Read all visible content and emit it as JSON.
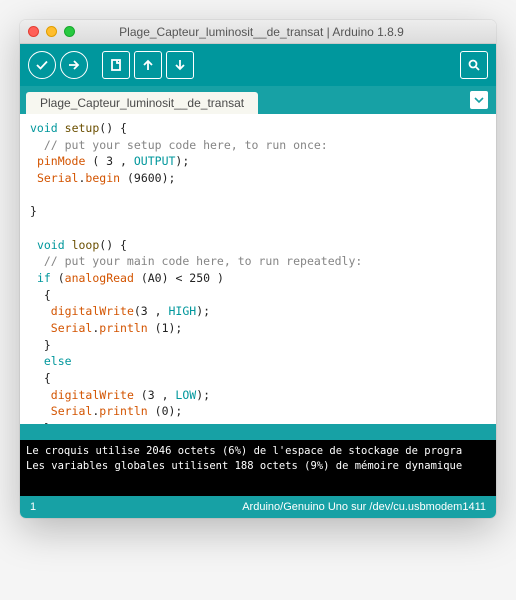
{
  "window": {
    "title": "Plage_Capteur_luminosit__de_transat | Arduino 1.8.9"
  },
  "tabs": {
    "active": "Plage_Capteur_luminosit__de_transat"
  },
  "code": {
    "l1a": "void",
    "l1b": " ",
    "l1c": "setup",
    "l1d": "() {",
    "l2": "  // put your setup code here, to run once:",
    "l3a": " ",
    "l3b": "pinMode",
    "l3c": " ( 3 , ",
    "l3d": "OUTPUT",
    "l3e": ");",
    "l4a": " ",
    "l4b": "Serial",
    "l4c": ".",
    "l4d": "begin",
    "l4e": " (9600);",
    "l5": "",
    "l6": "}",
    "l7": "",
    "l8a": " ",
    "l8b": "void",
    "l8c": " ",
    "l8d": "loop",
    "l8e": "() {",
    "l9": "  // put your main code here, to run repeatedly:",
    "l10a": " ",
    "l10b": "if",
    "l10c": " (",
    "l10d": "analogRead",
    "l10e": " (A0) < 250 )",
    "l11": "  {",
    "l12a": "   ",
    "l12b": "digitalWrite",
    "l12c": "(3 , ",
    "l12d": "HIGH",
    "l12e": ");",
    "l13a": "   ",
    "l13b": "Serial",
    "l13c": ".",
    "l13d": "println",
    "l13e": " (1);",
    "l14": "  }",
    "l15a": "  ",
    "l15b": "else",
    "l16": "  {",
    "l17a": "   ",
    "l17b": "digitalWrite",
    "l17c": " (3 , ",
    "l17d": "LOW",
    "l17e": ");",
    "l18a": "   ",
    "l18b": "Serial",
    "l18c": ".",
    "l18d": "println",
    "l18e": " (0);",
    "l19": "  }",
    "l20": " }"
  },
  "console": {
    "line1": "Le croquis utilise 2046 octets (6%) de l'espace de stockage de progra",
    "line2": "Les variables globales utilisent 188 octets (9%) de mémoire dynamique"
  },
  "status": {
    "line": "1",
    "board": "Arduino/Genuino Uno sur /dev/cu.usbmodem1411"
  }
}
